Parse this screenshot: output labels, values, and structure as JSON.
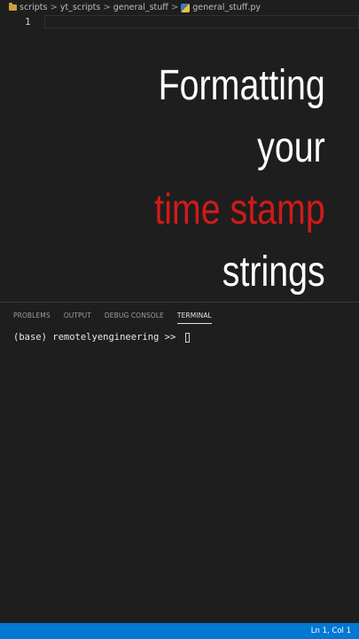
{
  "breadcrumb": {
    "items": [
      "scripts",
      "yt_scripts",
      "general_stuff",
      "general_stuff.py"
    ],
    "separator": ">"
  },
  "editor": {
    "line_number": "1"
  },
  "overlay": {
    "line1": "Formatting",
    "line2": "your",
    "line3": "time stamp",
    "line4": "strings",
    "accent_color": "#d11a1a"
  },
  "panel": {
    "tabs": [
      "PROBLEMS",
      "OUTPUT",
      "DEBUG CONSOLE",
      "TERMINAL"
    ],
    "active_tab": "TERMINAL"
  },
  "terminal": {
    "prompt": "(base) remotelyengineering >> "
  },
  "status_bar": {
    "position": "Ln 1, Col 1",
    "color": "#0078d4"
  }
}
